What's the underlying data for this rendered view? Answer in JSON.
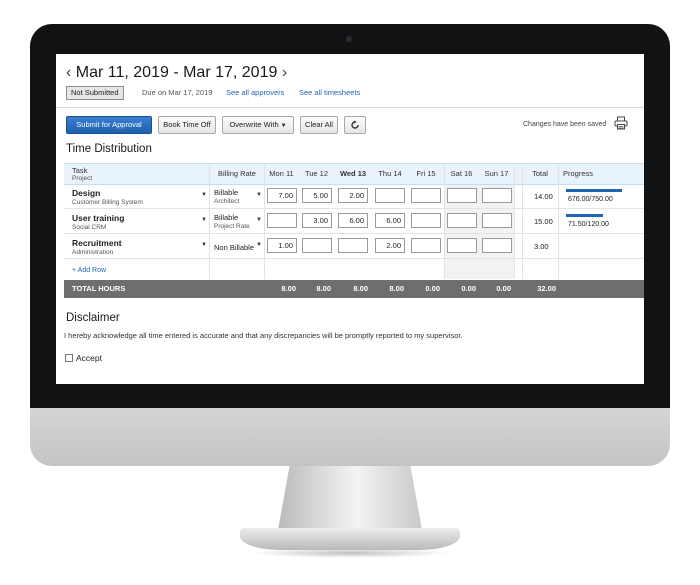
{
  "header": {
    "date_range": "Mar 11, 2019 - Mar 17, 2019",
    "status": "Not Submitted",
    "due": "Due on Mar 17, 2019",
    "link_approvers": "See all approvers",
    "link_timesheets": "See all timesheets"
  },
  "toolbar": {
    "submit": "Submit for Approval",
    "book_time_off": "Book Time Off",
    "overwrite_with": "Overwrite With",
    "clear_all": "Clear All",
    "saved_status": "Changes have been saved"
  },
  "time_distribution": {
    "title": "Time Distribution",
    "columns": {
      "task": "Task",
      "project": "Project",
      "billing_rate": "Billing Rate",
      "days": [
        "Mon 11",
        "Tue 12",
        "Wed 13",
        "Thu 14",
        "Fri 15",
        "Sat 16",
        "Sun 17"
      ],
      "total": "Total",
      "progress": "Progress"
    },
    "rows": [
      {
        "task": "Design",
        "project": "Customer Billing System",
        "billing": "Billable",
        "rate": "Architect",
        "hours": [
          "7.00",
          "5.00",
          "2.00",
          "",
          "",
          "",
          ""
        ],
        "total": "14.00",
        "progress": "676.00/750.00",
        "progress_fraction": 0.9
      },
      {
        "task": "User training",
        "project": "Social CRM",
        "billing": "Billable",
        "rate": "Project Rate",
        "hours": [
          "",
          "3.00",
          "6.00",
          "6.00",
          "",
          "",
          ""
        ],
        "total": "15.00",
        "progress": "71.50/120.00",
        "progress_fraction": 0.6
      },
      {
        "task": "Recruitment",
        "project": "Administration",
        "billing": "Non Billable",
        "rate": "",
        "hours": [
          "1.00",
          "",
          "",
          "2.00",
          "",
          "",
          ""
        ],
        "total": "3.00",
        "progress": "",
        "progress_fraction": 0
      }
    ],
    "add_row": "+ Add Row",
    "totals": {
      "label": "TOTAL HOURS",
      "days": [
        "8.00",
        "8.00",
        "8.00",
        "8.00",
        "0.00",
        "0.00",
        "0.00"
      ],
      "grand_total": "32.00"
    }
  },
  "disclaimer": {
    "title": "Disclaimer",
    "text": "I hereby acknowledge all time entered is accurate and that any discrepancies will be promptly reported to my supervisor.",
    "accept_label": "Accept"
  }
}
